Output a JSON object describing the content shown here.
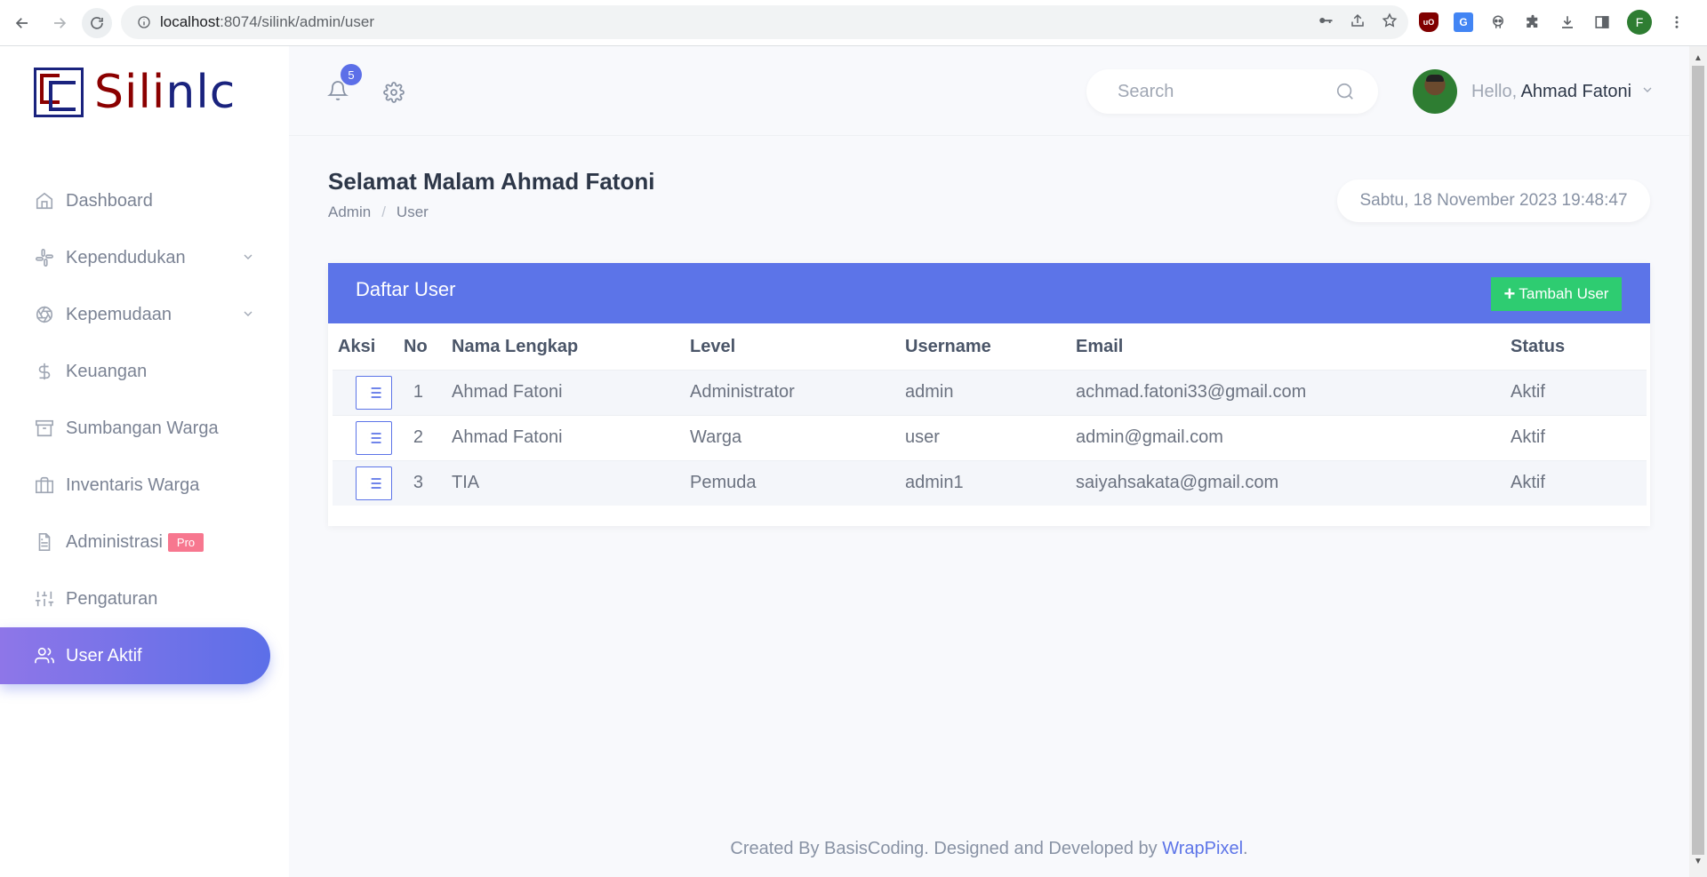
{
  "browser": {
    "url_host": "localhost",
    "url_path": ":8074/silink/admin/user",
    "profile_initial": "F"
  },
  "logo": {
    "text_a": "Sili",
    "text_b": "nlc"
  },
  "sidebar": {
    "items": [
      {
        "label": "Dashboard",
        "icon": "home-icon",
        "has_chevron": false
      },
      {
        "label": "Kependudukan",
        "icon": "slack-icon",
        "has_chevron": true
      },
      {
        "label": "Kepemudaan",
        "icon": "aperture-icon",
        "has_chevron": true
      },
      {
        "label": "Keuangan",
        "icon": "dollar-icon",
        "has_chevron": false
      },
      {
        "label": "Sumbangan Warga",
        "icon": "archive-icon",
        "has_chevron": false
      },
      {
        "label": "Inventaris Warga",
        "icon": "briefcase-icon",
        "has_chevron": false
      },
      {
        "label": "Administrasi",
        "icon": "file-text-icon",
        "has_chevron": false,
        "badge": "Pro"
      },
      {
        "label": "Pengaturan",
        "icon": "sliders-icon",
        "has_chevron": false
      },
      {
        "label": "User Aktif",
        "icon": "users-icon",
        "has_chevron": false,
        "active": true
      }
    ]
  },
  "header": {
    "notification_count": "5",
    "search_placeholder": "Search",
    "hello": "Hello,",
    "user_name": "Ahmad Fatoni"
  },
  "page": {
    "greeting": "Selamat Malam Ahmad Fatoni",
    "breadcrumb": [
      "Admin",
      "User"
    ],
    "datetime": "Sabtu, 18 November 2023 19:48:47"
  },
  "card": {
    "title": "Daftar User",
    "add_button": "Tambah User",
    "columns": [
      "Aksi",
      "No",
      "Nama Lengkap",
      "Level",
      "Username",
      "Email",
      "Status"
    ],
    "rows": [
      {
        "no": "1",
        "nama": "Ahmad Fatoni",
        "level": "Administrator",
        "username": "admin",
        "email": "achmad.fatoni33@gmail.com",
        "status": "Aktif"
      },
      {
        "no": "2",
        "nama": "Ahmad Fatoni",
        "level": "Warga",
        "username": "user",
        "email": "admin@gmail.com",
        "status": "Aktif"
      },
      {
        "no": "3",
        "nama": "TIA",
        "level": "Pemuda",
        "username": "admin1",
        "email": "saiyahsakata@gmail.com",
        "status": "Aktif"
      }
    ]
  },
  "footer": {
    "text": "Created By BasisCoding. Designed and Developed by ",
    "link": "WrapPixel",
    "end": "."
  },
  "colors": {
    "accent": "#5c74e8",
    "success": "#2ecc71",
    "badge_pro": "#f7778f"
  }
}
